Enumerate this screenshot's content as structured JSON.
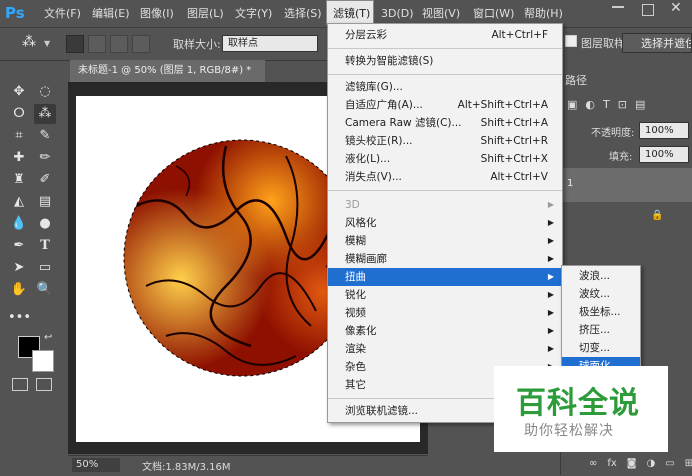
{
  "app": {
    "logo": "Ps"
  },
  "menubar": {
    "items": [
      {
        "label": "文件(F)"
      },
      {
        "label": "编辑(E)"
      },
      {
        "label": "图像(I)"
      },
      {
        "label": "图层(L)"
      },
      {
        "label": "文字(Y)"
      },
      {
        "label": "选择(S)"
      },
      {
        "label": "滤镜(T)"
      },
      {
        "label": "3D(D)"
      },
      {
        "label": "视图(V)"
      },
      {
        "label": "窗口(W)"
      },
      {
        "label": "帮助(H)"
      }
    ]
  },
  "options_bar": {
    "sample_size_label": "取样大小:",
    "sample_size_value": "取样点",
    "layer_sample_label": "图层取样",
    "select_subject_label": "选择并遮住..."
  },
  "document": {
    "tab_title": "未标题-1 @ 50% (图层 1, RGB/8#) *",
    "zoom": "50%",
    "doc_size": "文档:1.83M/3.16M"
  },
  "right_panel": {
    "panel_tab": "路径",
    "opacity_label": "不透明度:",
    "opacity_value": "100%",
    "fill_label": "填充:",
    "fill_value": "100%",
    "layer_row_label": "1"
  },
  "filter_menu": {
    "top_items": [
      {
        "label": "分层云彩",
        "shortcut": "Alt+Ctrl+F"
      }
    ],
    "smart_items": [
      {
        "label": "转换为智能滤镜(S)"
      }
    ],
    "gallery_items": [
      {
        "label": "滤镜库(G)...",
        "shortcut": ""
      },
      {
        "label": "自适应广角(A)...",
        "shortcut": "Alt+Shift+Ctrl+A"
      },
      {
        "label": "Camera Raw 滤镜(C)...",
        "shortcut": "Shift+Ctrl+A"
      },
      {
        "label": "镜头校正(R)...",
        "shortcut": "Shift+Ctrl+R"
      },
      {
        "label": "液化(L)...",
        "shortcut": "Shift+Ctrl+X"
      },
      {
        "label": "消失点(V)...",
        "shortcut": "Alt+Ctrl+V"
      }
    ],
    "submenu_items": [
      {
        "label": "3D",
        "disabled": true
      },
      {
        "label": "风格化"
      },
      {
        "label": "模糊"
      },
      {
        "label": "模糊画廊"
      },
      {
        "label": "扭曲",
        "highlighted": true
      },
      {
        "label": "锐化"
      },
      {
        "label": "视频"
      },
      {
        "label": "像素化"
      },
      {
        "label": "渲染"
      },
      {
        "label": "杂色"
      },
      {
        "label": "其它"
      }
    ],
    "bottom_items": [
      {
        "label": "浏览联机滤镜..."
      }
    ]
  },
  "distort_submenu": {
    "items": [
      {
        "label": "波浪..."
      },
      {
        "label": "波纹..."
      },
      {
        "label": "极坐标..."
      },
      {
        "label": "挤压..."
      },
      {
        "label": "切变..."
      },
      {
        "label": "球面化...",
        "highlighted": true
      }
    ]
  },
  "watermark": {
    "title": "百科全说",
    "subtitle": "助你轻松解决"
  },
  "colors": {
    "ui_bg": "#535353",
    "menu_bg": "#f2f2f2",
    "highlight": "#1f6fd1",
    "watermark_green": "#2e9b3b",
    "fire_dark": "#7a0b00",
    "fire_bright": "#ffb21a"
  },
  "icons": {
    "tools": [
      "move-icon",
      "elliptical-marquee-icon",
      "lasso-icon",
      "magic-wand-icon",
      "crop-icon",
      "eyedropper-icon",
      "healing-brush-icon",
      "brush-icon",
      "clone-stamp-icon",
      "history-brush-icon",
      "eraser-icon",
      "gradient-icon",
      "blur-icon",
      "dodge-icon",
      "pen-icon",
      "type-icon",
      "path-selection-icon",
      "rectangle-icon",
      "hand-icon",
      "zoom-icon",
      "more-tools-icon"
    ]
  }
}
